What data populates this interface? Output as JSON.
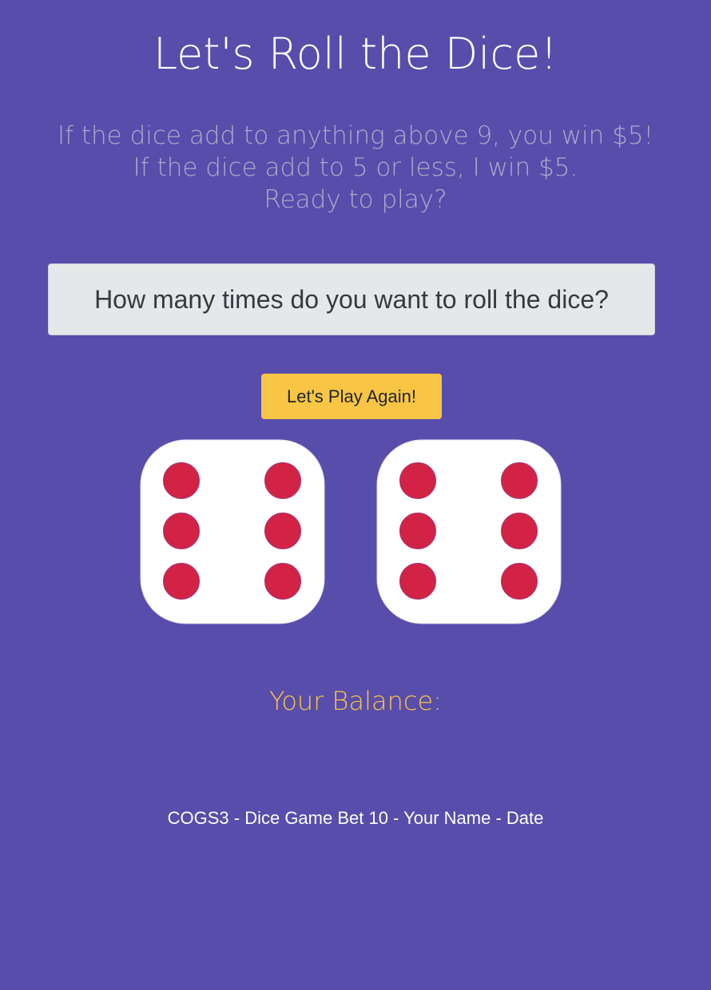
{
  "header": {
    "title": "Let's Roll the Dice!"
  },
  "rules": {
    "line1": "If the dice add to anything above 9, you win $5!",
    "line2": "If the dice add to 5 or less, I win $5.",
    "line3": "Ready to play?"
  },
  "rolls_input": {
    "value": "",
    "placeholder": "How many times do you want to roll the dice?"
  },
  "play_button": {
    "label": "Let's Play Again!"
  },
  "dice": [
    {
      "value": 6,
      "pip_color": "#d22344",
      "face_color": "#ffffff"
    },
    {
      "value": 6,
      "pip_color": "#d22344",
      "face_color": "#ffffff"
    }
  ],
  "balance": {
    "label": "Your Balance:"
  },
  "footer": {
    "text": "COGS3 - Dice Game Bet 10 - Your Name - Date"
  },
  "colors": {
    "background": "#584dab",
    "accent": "#f8c544"
  }
}
